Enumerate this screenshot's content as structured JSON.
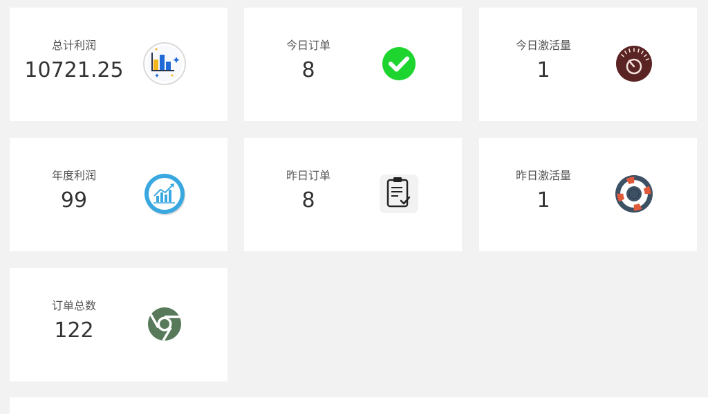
{
  "cards": [
    {
      "label": "总计利润",
      "value": "10721.25",
      "icon": "bar-chart-icon"
    },
    {
      "label": "今日订单",
      "value": "8",
      "icon": "check-circle-icon"
    },
    {
      "label": "今日激活量",
      "value": "1",
      "icon": "speed-gauge-icon"
    },
    {
      "label": "年度利润",
      "value": "99",
      "icon": "growth-chart-icon"
    },
    {
      "label": "昨日订单",
      "value": "8",
      "icon": "clipboard-check-icon"
    },
    {
      "label": "昨日激活量",
      "value": "1",
      "icon": "lifebuoy-icon"
    },
    {
      "label": "订单总数",
      "value": "122",
      "icon": "chrome-icon"
    }
  ],
  "colors": {
    "page_background": "#f2f2f2",
    "card_background": "#ffffff",
    "check_green": "#1ed530",
    "gauge_brown": "#5b2424",
    "growth_blue": "#3aa8e0",
    "lifebuoy_slate": "#3d5165",
    "lifebuoy_red": "#e05a3a",
    "chrome_green": "#587a5b"
  }
}
